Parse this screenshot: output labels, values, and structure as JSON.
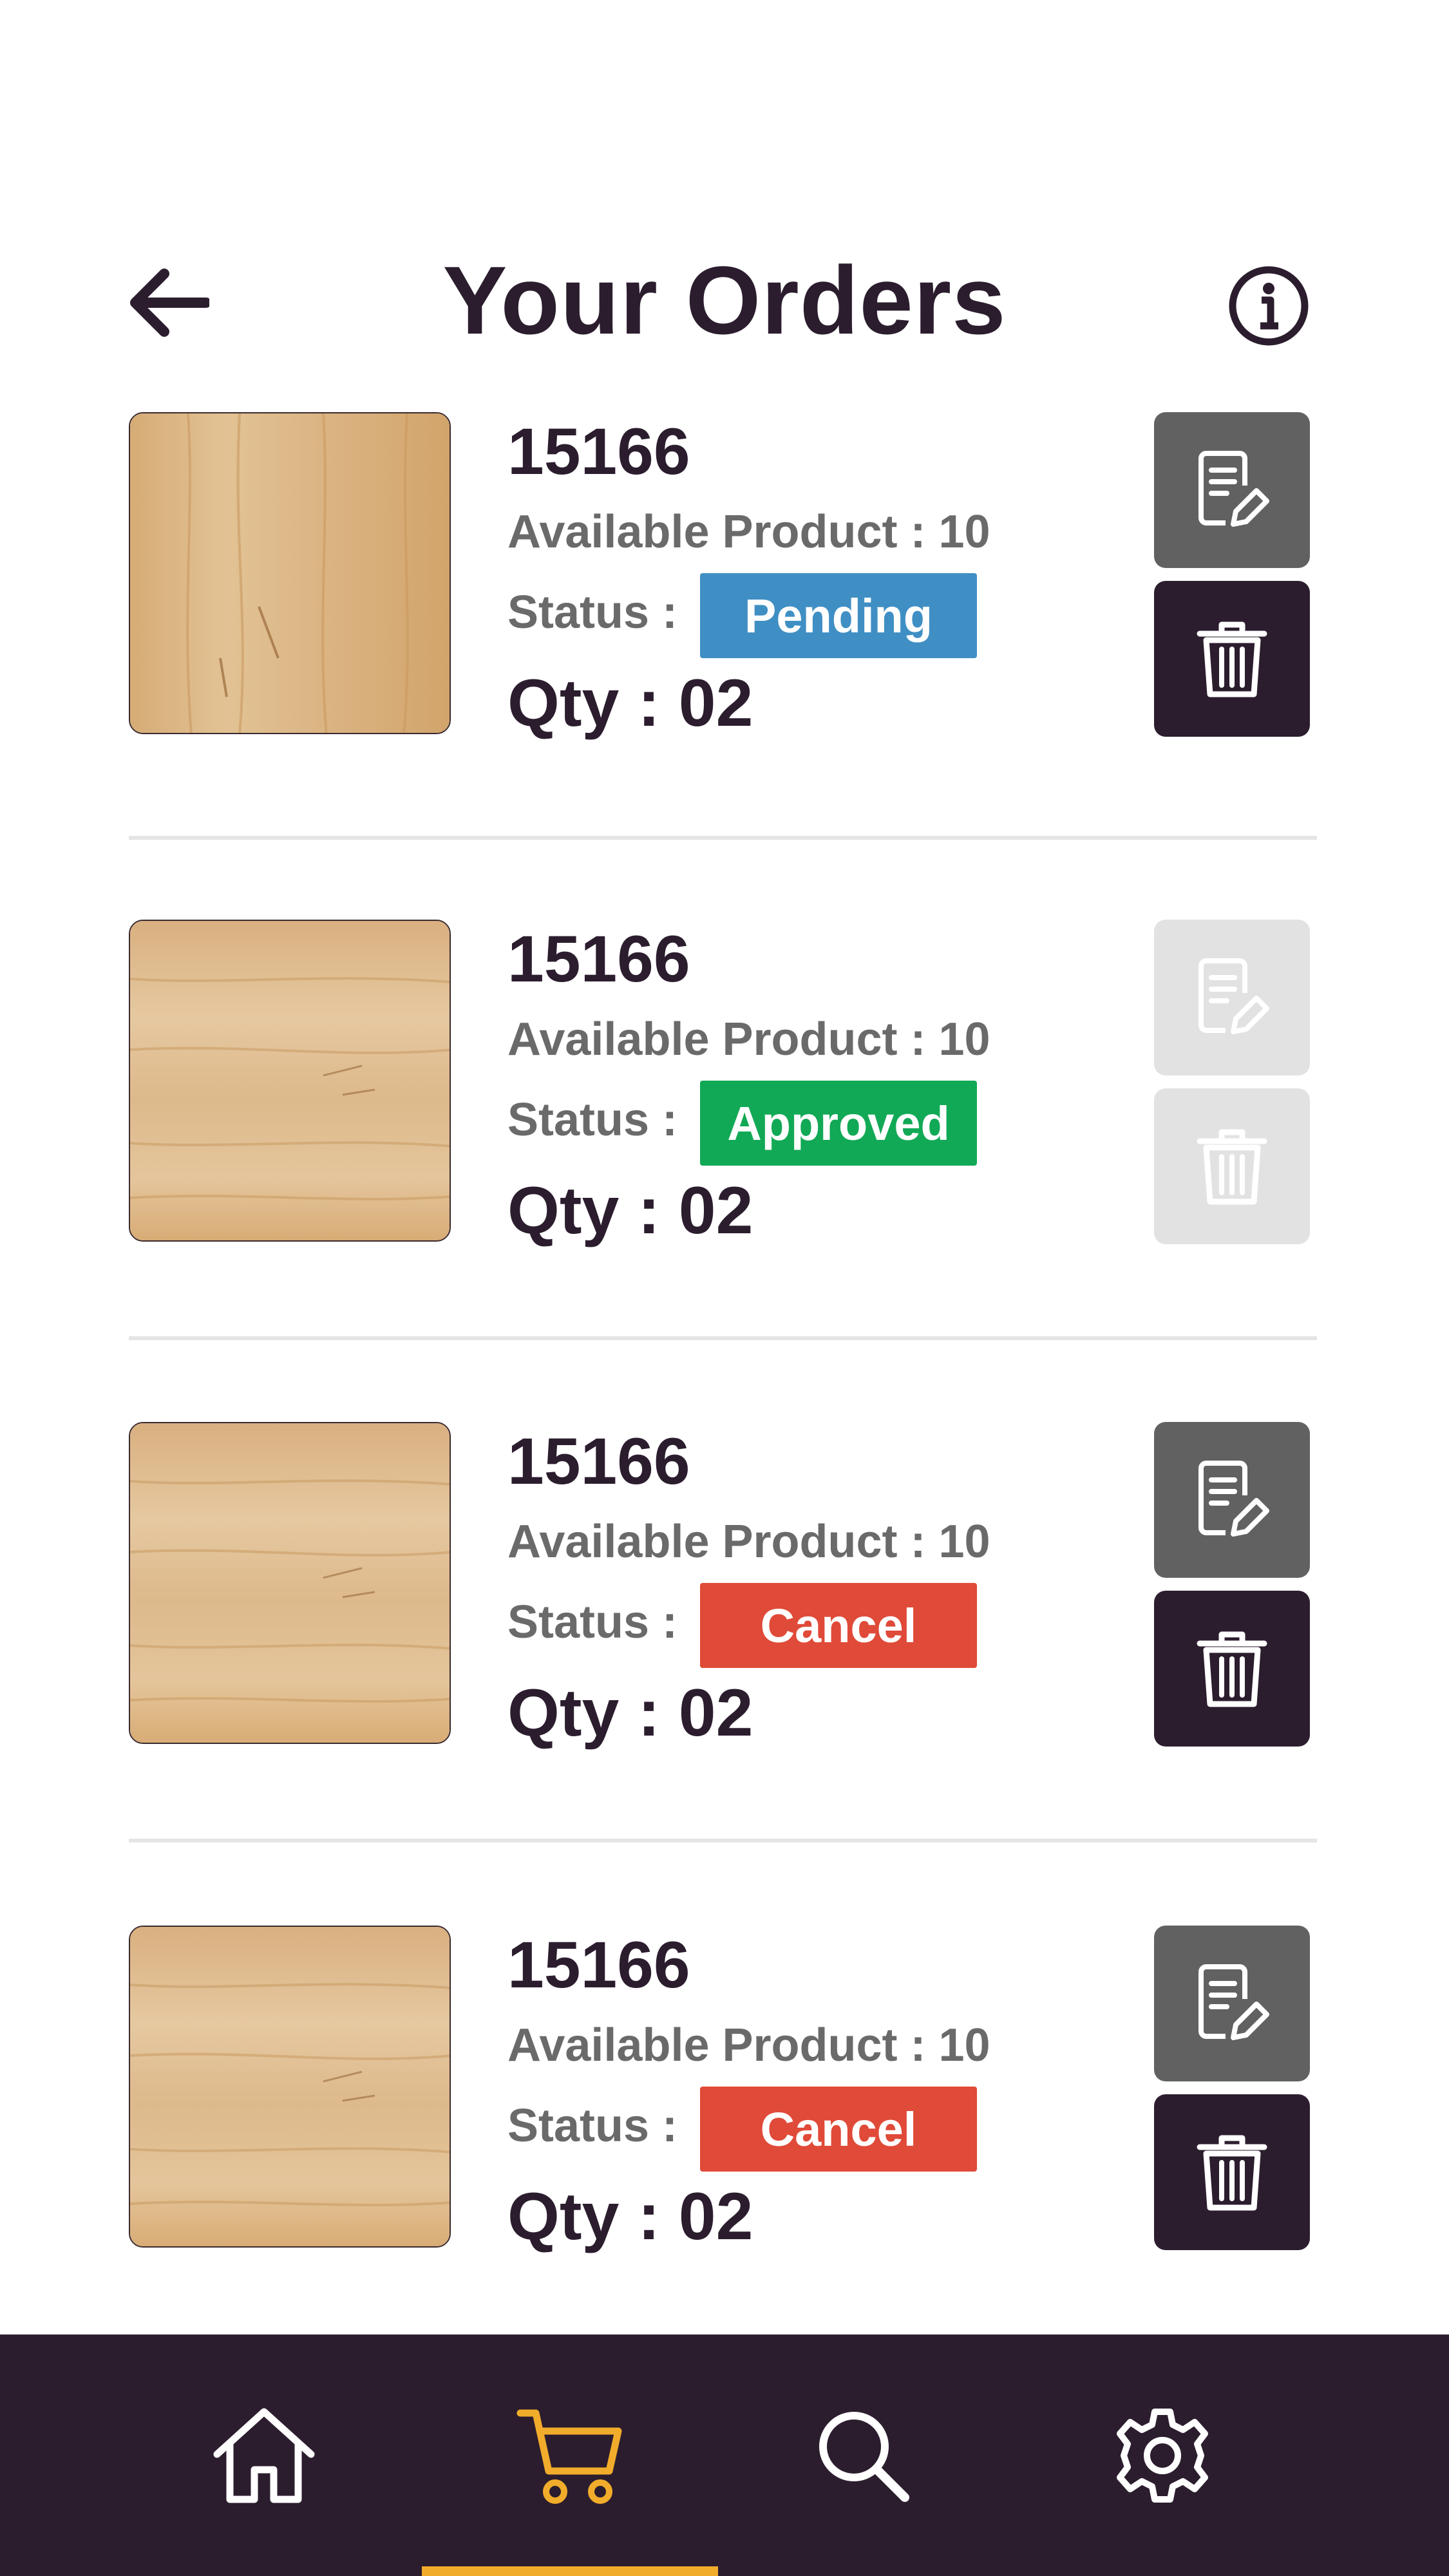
{
  "header": {
    "title": "Your Orders"
  },
  "orders": [
    {
      "id": "15166",
      "available": "Available Product : 10",
      "status_label": "Status :",
      "status": "Pending",
      "status_color": "#3f8fc4",
      "qty": "Qty : 02",
      "actions_enabled": true
    },
    {
      "id": "15166",
      "available": "Available Product : 10",
      "status_label": "Status :",
      "status": "Approved",
      "status_color": "#12a956",
      "qty": "Qty : 02",
      "actions_enabled": false
    },
    {
      "id": "15166",
      "available": "Available Product : 10",
      "status_label": "Status :",
      "status": "Cancel",
      "status_color": "#e04a38",
      "qty": "Qty : 02",
      "actions_enabled": true
    },
    {
      "id": "15166",
      "available": "Available Product : 10",
      "status_label": "Status :",
      "status": "Cancel",
      "status_color": "#e04a38",
      "qty": "Qty : 02",
      "actions_enabled": true
    }
  ],
  "nav": {
    "items": [
      "home-icon",
      "cart-icon",
      "search-icon",
      "gear-icon"
    ],
    "active": "cart-icon",
    "active_color": "#f2ac2b",
    "background": "#2b1d2e"
  }
}
